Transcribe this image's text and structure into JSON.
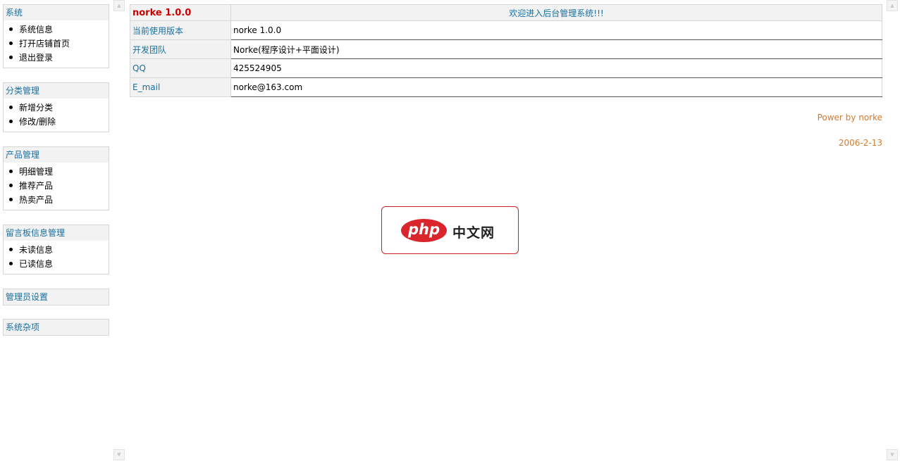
{
  "sidebar": {
    "groups": [
      {
        "title": "系统",
        "items": [
          "系统信息",
          "打开店铺首页",
          "退出登录"
        ]
      },
      {
        "title": "分类管理",
        "items": [
          "新增分类",
          "修改/删除"
        ]
      },
      {
        "title": "产品管理",
        "items": [
          "明细管理",
          "推荐产品",
          "热卖产品"
        ]
      },
      {
        "title": "留言板信息管理",
        "items": [
          "未读信息",
          "已读信息"
        ]
      },
      {
        "title": "管理员设置",
        "items": []
      },
      {
        "title": "系统杂项",
        "items": []
      }
    ]
  },
  "info": {
    "version_title": "norke 1.0.0",
    "welcome": "欢迎进入后台管理系统!!!",
    "rows": [
      {
        "label": "当前使用版本",
        "value": "norke 1.0.0"
      },
      {
        "label": "开发团队",
        "value": "Norke(程序设计+平面设计)"
      },
      {
        "label": "QQ",
        "value": "425524905"
      },
      {
        "label": "E_mail",
        "value": "norke@163.com"
      }
    ]
  },
  "footer": {
    "power": "Power by norke",
    "date": "2006-2-13"
  },
  "watermark": {
    "logo_text": "php",
    "logo_cn": "中文网"
  },
  "icons": {
    "scroll_up": "scroll-up-arrow",
    "scroll_down": "scroll-down-arrow"
  },
  "colors": {
    "link": "#1a6fa0",
    "version": "#cc0000",
    "footer": "#d27a2c",
    "logo": "#d9252b"
  }
}
